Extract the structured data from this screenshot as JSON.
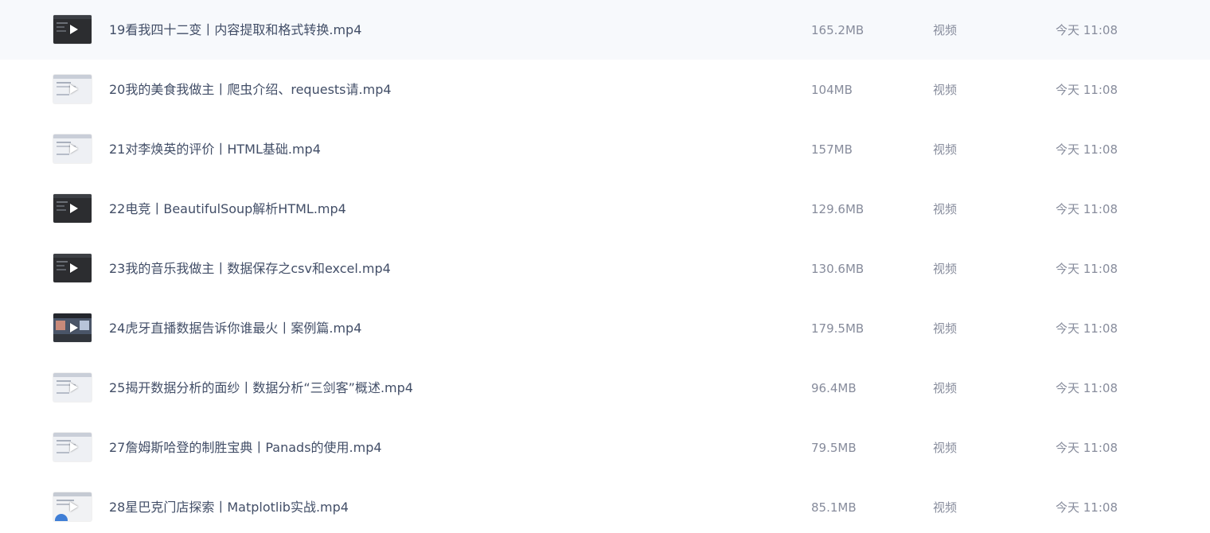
{
  "files": [
    {
      "name": "19看我四十二变丨内容提取和格式转换.mp4",
      "size": "165.2MB",
      "type": "视频",
      "modified": "今天 11:08",
      "thumb_style": "dark"
    },
    {
      "name": "20我的美食我做主丨爬虫介绍、requests请.mp4",
      "size": "104MB",
      "type": "视频",
      "modified": "今天 11:08",
      "thumb_style": "light"
    },
    {
      "name": "21对李焕英的评价丨HTML基础.mp4",
      "size": "157MB",
      "type": "视频",
      "modified": "今天 11:08",
      "thumb_style": "light"
    },
    {
      "name": "22电竞丨BeautifulSoup解析HTML.mp4",
      "size": "129.6MB",
      "type": "视频",
      "modified": "今天 11:08",
      "thumb_style": "dark"
    },
    {
      "name": "23我的音乐我做主丨数据保存之csv和excel.mp4",
      "size": "130.6MB",
      "type": "视频",
      "modified": "今天 11:08",
      "thumb_style": "dark"
    },
    {
      "name": "24虎牙直播数据告诉你谁最火丨案例篇.mp4",
      "size": "179.5MB",
      "type": "视频",
      "modified": "今天 11:08",
      "thumb_style": "photo"
    },
    {
      "name": "25揭开数据分析的面纱丨数据分析“三剑客”概述.mp4",
      "size": "96.4MB",
      "type": "视频",
      "modified": "今天 11:08",
      "thumb_style": "light"
    },
    {
      "name": "27詹姆斯哈登的制胜宝典丨Panads的使用.mp4",
      "size": "79.5MB",
      "type": "视频",
      "modified": "今天 11:08",
      "thumb_style": "light"
    },
    {
      "name": "28星巴克门店探索丨Matplotlib实战.mp4",
      "size": "85.1MB",
      "type": "视频",
      "modified": "今天 11:08",
      "thumb_style": "chart"
    }
  ],
  "icons": {
    "thumbnail_overlay": "play-icon"
  }
}
